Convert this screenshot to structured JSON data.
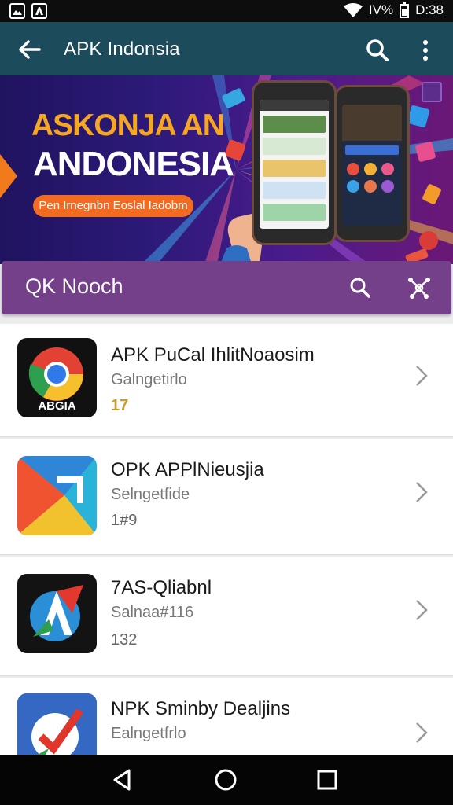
{
  "status_bar": {
    "signal_text": "IV%",
    "time": "D:38"
  },
  "app_bar": {
    "title": "APK Indonsia"
  },
  "banner": {
    "headline_line1": "ASKONJA AN",
    "headline_line2": "ANDONESIA",
    "cta_label": "Pen Irnegnbn Eoslal Iadobm",
    "indicator_count": 3,
    "active_indicator": 0
  },
  "purple_bar": {
    "title": "QK Nooch"
  },
  "list": {
    "items": [
      {
        "title": "APK PuCal IhlitNoaosim",
        "subtitle": "Galngetirlo",
        "meta": "17",
        "icon": "chrome-style-icon",
        "icon_label": "ABGIA",
        "meta_color": "#c99a2e"
      },
      {
        "title": "OPK APPlNieusjia",
        "subtitle": "Selngetfide",
        "meta": "1#9",
        "icon": "play-arrow-icon"
      },
      {
        "title": "7AS-Qliabnl",
        "subtitle": "Salnaa#116",
        "meta": "132",
        "icon": "a-logo-icon"
      },
      {
        "title": "NPK Sminby Dealjins",
        "subtitle": "Ealngetfrlo",
        "meta": "",
        "icon": "check-chat-icon"
      }
    ]
  },
  "colors": {
    "app_bar": "#1c4b5c",
    "purple_bar": "#74408a",
    "banner_orange": "#f36b21",
    "banner_gold": "#f5a623"
  }
}
